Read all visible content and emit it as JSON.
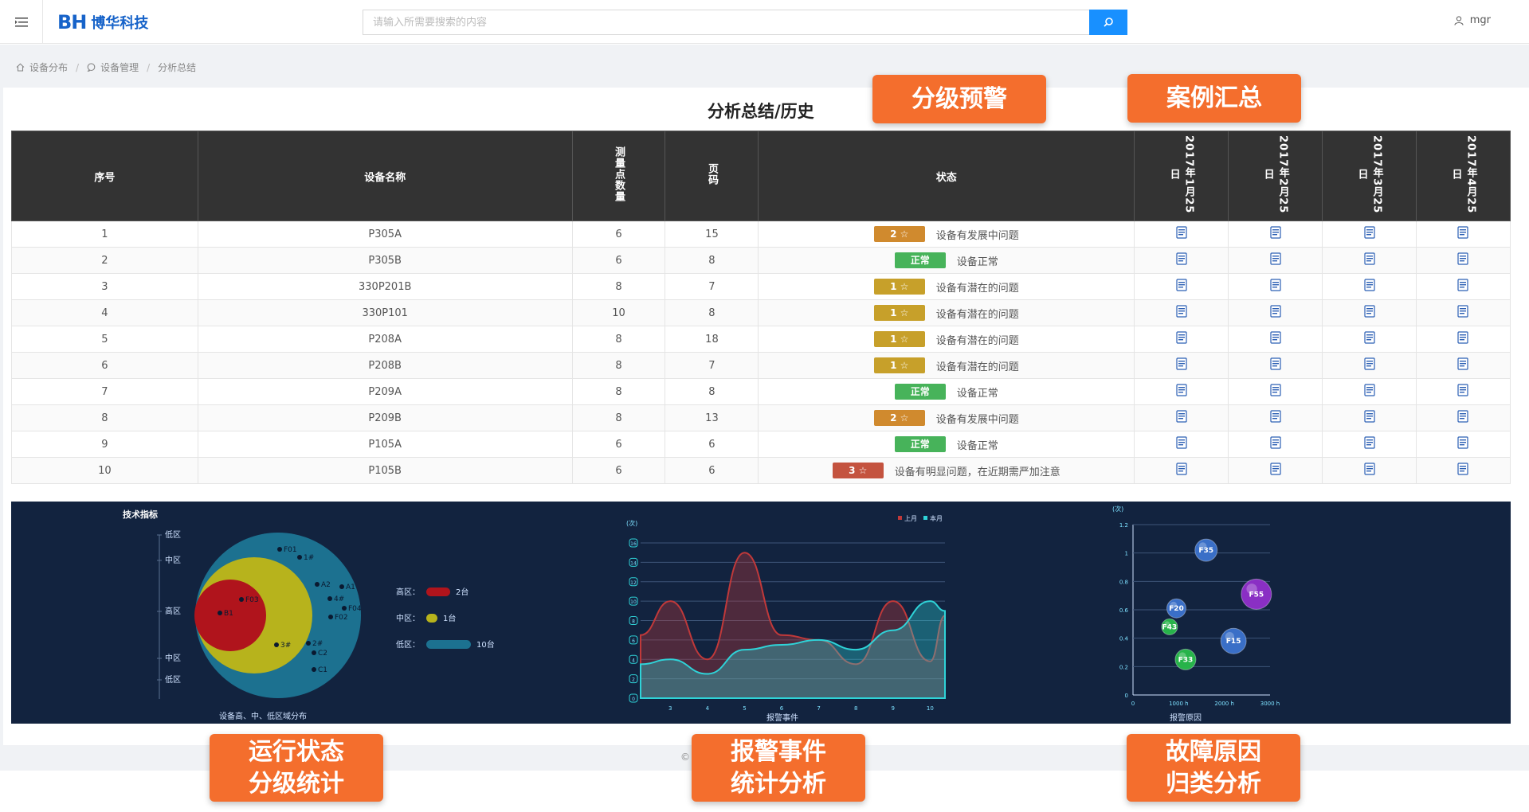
{
  "header": {
    "logo_mark": "BH",
    "logo_name": "博华科技",
    "search_placeholder": "请输入所需要搜索的内容",
    "user": "mgr"
  },
  "breadcrumb": [
    "设备分布",
    "设备管理",
    "分析总结"
  ],
  "page_title": "分析总结/历史",
  "callouts": {
    "grading_warning": "分级预警",
    "case_summary": "案例汇总",
    "run_status_1": "运行状态",
    "run_status_2": "分级统计",
    "alarm_1": "报警事件",
    "alarm_2": "统计分析",
    "fault_1": "故障原因",
    "fault_2": "归类分析"
  },
  "table": {
    "headers": {
      "index": "序号",
      "device": "设备名称",
      "points": "测量点数量",
      "pages": "页码",
      "status": "状态",
      "d1": "2017年1月25日",
      "d2": "2017年2月25日",
      "d3": "2017年3月25日",
      "d4": "2017年4月25日"
    },
    "rows": [
      {
        "idx": "1",
        "name": "P305A",
        "points": "6",
        "page": "15",
        "badge": "2 ☆",
        "color": "#d08a2e",
        "text": "设备有发展中问题"
      },
      {
        "idx": "2",
        "name": "P305B",
        "points": "6",
        "page": "8",
        "badge": "正常",
        "color": "#47b35a",
        "text": "设备正常"
      },
      {
        "idx": "3",
        "name": "330P201B",
        "points": "8",
        "page": "7",
        "badge": "1 ☆",
        "color": "#c7a02a",
        "text": "设备有潜在的问题"
      },
      {
        "idx": "4",
        "name": "330P101",
        "points": "10",
        "page": "8",
        "badge": "1 ☆",
        "color": "#c7a02a",
        "text": "设备有潜在的问题"
      },
      {
        "idx": "5",
        "name": "P208A",
        "points": "8",
        "page": "18",
        "badge": "1 ☆",
        "color": "#c7a02a",
        "text": "设备有潜在的问题"
      },
      {
        "idx": "6",
        "name": "P208B",
        "points": "8",
        "page": "7",
        "badge": "1 ☆",
        "color": "#c7a02a",
        "text": "设备有潜在的问题"
      },
      {
        "idx": "7",
        "name": "P209A",
        "points": "8",
        "page": "8",
        "badge": "正常",
        "color": "#47b35a",
        "text": "设备正常"
      },
      {
        "idx": "8",
        "name": "P209B",
        "points": "8",
        "page": "13",
        "badge": "2 ☆",
        "color": "#d08a2e",
        "text": "设备有发展中问题"
      },
      {
        "idx": "9",
        "name": "P105A",
        "points": "6",
        "page": "6",
        "badge": "正常",
        "color": "#47b35a",
        "text": "设备正常"
      },
      {
        "idx": "10",
        "name": "P105B",
        "points": "6",
        "page": "6",
        "badge": "3 ☆",
        "color": "#c4533f",
        "text": "设备有明显问题，在近期需严加注意"
      }
    ]
  },
  "dashboard": {
    "zone_chart": {
      "title": "技术指标",
      "caption": "设备高、中、低区域分布",
      "axis_labels": [
        "低区",
        "中区",
        "高区",
        "中区",
        "低区"
      ],
      "points": [
        "F01",
        "1#",
        "A2",
        "A1",
        "4#",
        "F04",
        "F02",
        "F03",
        "B1",
        "3#",
        "2#",
        "C2",
        "C1"
      ],
      "legend": [
        {
          "label": "高区：",
          "value": "2台",
          "color": "#b0141c"
        },
        {
          "label": "中区：",
          "value": "1台",
          "color": "#b7b31c"
        },
        {
          "label": "低区：",
          "value": "10台",
          "color": "#1c7190"
        }
      ]
    },
    "alarm_chart": {
      "unit": "(次)",
      "xlabel": "报警事件",
      "legend": [
        "上月",
        "本月"
      ],
      "colors": [
        "#c0393a",
        "#2fd3d8"
      ],
      "x_ticks": [
        "3",
        "4",
        "5",
        "6",
        "7",
        "8",
        "9",
        "10"
      ],
      "y_ticks": [
        "0",
        "2",
        "4",
        "6",
        "8",
        "10",
        "12",
        "14",
        "16"
      ]
    },
    "fault_chart": {
      "unit": "(次)",
      "xlabel": "报警原因",
      "x_ticks": [
        "0",
        "1000 h",
        "2000 h",
        "3000 h"
      ],
      "y_ticks": [
        "0",
        "0.2",
        "0.4",
        "0.6",
        "0.8",
        "1",
        "1.2"
      ],
      "bubbles": [
        {
          "label": "F35",
          "x": 1600,
          "y": 1.02,
          "color": "#3a6fc7"
        },
        {
          "label": "F55",
          "x": 2700,
          "y": 0.71,
          "color": "#8a2fc4"
        },
        {
          "label": "F20",
          "x": 950,
          "y": 0.61,
          "color": "#3a6fc7"
        },
        {
          "label": "F43",
          "x": 800,
          "y": 0.48,
          "color": "#27b34a"
        },
        {
          "label": "F15",
          "x": 2200,
          "y": 0.38,
          "color": "#3a6fc7"
        },
        {
          "label": "F33",
          "x": 1150,
          "y": 0.25,
          "color": "#27b34a"
        }
      ]
    }
  },
  "footer": "©"
}
